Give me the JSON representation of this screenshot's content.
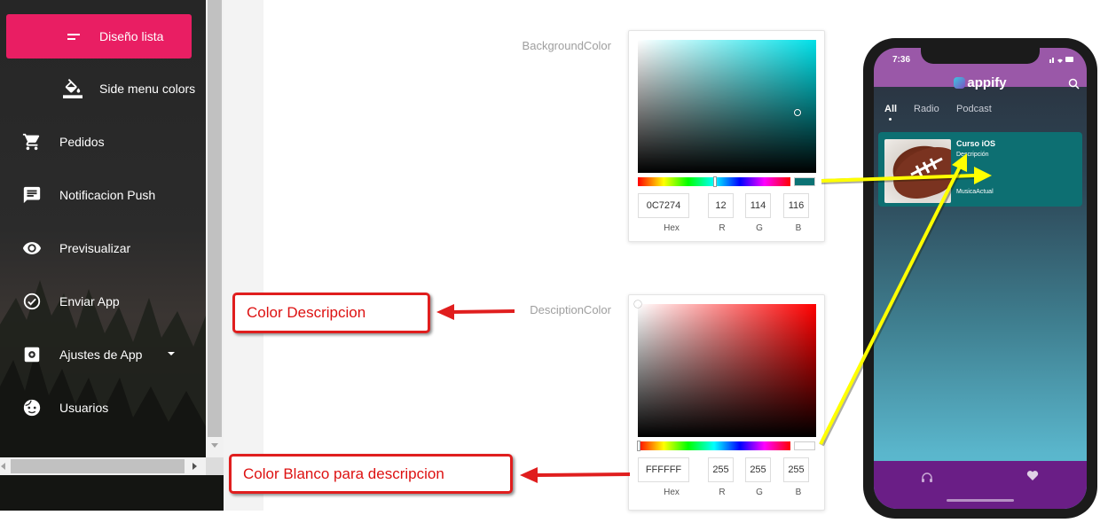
{
  "sidebar": {
    "items": [
      {
        "label": "Diseño lista",
        "icon": "list-icon",
        "active": true
      },
      {
        "label": "Side menu colors",
        "icon": "paint-bucket-icon",
        "sub": true
      },
      {
        "label": "Pedidos",
        "icon": "cart-icon"
      },
      {
        "label": "Notificacion Push",
        "icon": "feedback-icon"
      },
      {
        "label": "Previsualizar",
        "icon": "eye-icon"
      },
      {
        "label": "Enviar App",
        "icon": "check-circle-icon"
      },
      {
        "label": "Ajustes de App",
        "icon": "settings-icon",
        "has_caret": true
      },
      {
        "label": "Usuarios",
        "icon": "face-icon"
      }
    ]
  },
  "pickers": [
    {
      "label": "BackgroundColor",
      "hue_color": "#00E0E8",
      "swatch_color": "#0C7274",
      "hex": "0C7274",
      "r": "12",
      "g": "114",
      "b": "116",
      "captions": {
        "hex": "Hex",
        "r": "R",
        "g": "G",
        "b": "B"
      }
    },
    {
      "label": "DesciptionColor",
      "hue_color": "#FF0000",
      "swatch_color": "#FFFFFF",
      "hex": "FFFFFF",
      "r": "255",
      "g": "255",
      "b": "255",
      "captions": {
        "hex": "Hex",
        "r": "R",
        "g": "G",
        "b": "B"
      }
    }
  ],
  "callouts": {
    "description": "Color Descripcion",
    "white_description": "Color Blanco para descripcion"
  },
  "phone": {
    "time": "7:36",
    "app_name": "appify",
    "tabs": [
      "All",
      "Radio",
      "Podcast"
    ],
    "card": {
      "title": "Curso iOS",
      "description": "Descripción",
      "meta": "MusicaActual"
    },
    "colors": {
      "status_bar": "#9A58A8",
      "card": "#0D6F72",
      "bottom_bar": "#6A1E86"
    }
  },
  "colors": {
    "accent": "#E91E63",
    "callout_red": "#E01E1E",
    "annotation_yellow": "#FFFF00"
  }
}
